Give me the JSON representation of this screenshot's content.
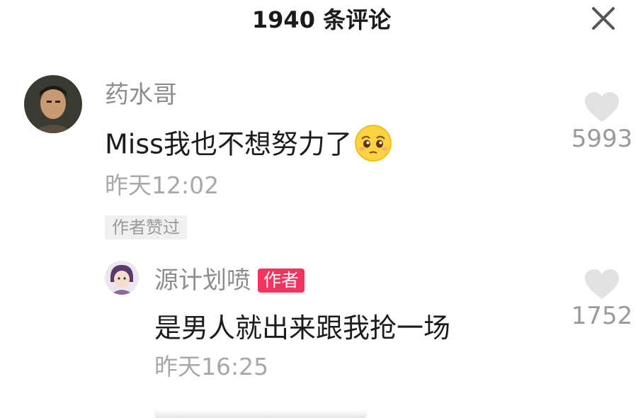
{
  "header": {
    "title": "1940 条评论",
    "close_icon": "close-icon"
  },
  "comments": [
    {
      "username": "药水哥",
      "text": "Miss我也不想努力了",
      "emoji": "pleading-face-emoji",
      "time": "昨天12:02",
      "liked_by_author_tag": "作者赞过",
      "like_icon": "heart-icon",
      "like_count": "5993",
      "replies": [
        {
          "username": "源计划喷",
          "author_badge": "作者",
          "text": "是男人就出来跟我抢一场",
          "time": "昨天16:25",
          "like_icon": "heart-icon",
          "like_count": "1752"
        }
      ]
    }
  ],
  "colors": {
    "author_badge": "#f5335f",
    "secondary_text": "#8d8d8d",
    "like_icon": "#e2e2e2"
  }
}
